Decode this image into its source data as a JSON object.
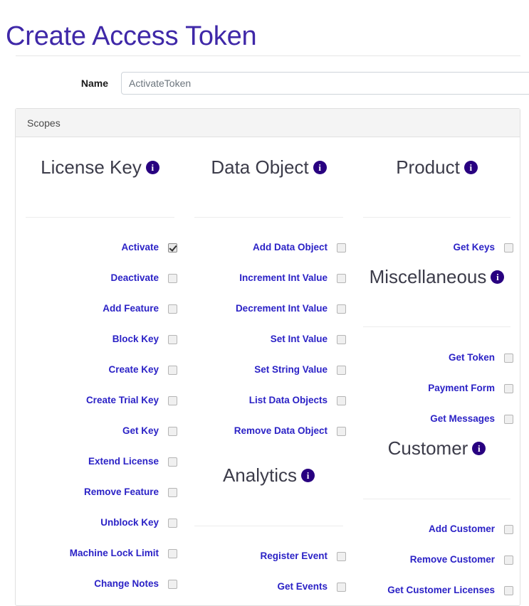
{
  "page": {
    "title": "Create Access Token"
  },
  "form": {
    "name_label": "Name",
    "name_value": "",
    "name_placeholder": "ActivateToken"
  },
  "scopes_card": {
    "header_label": "Scopes"
  },
  "icons": {
    "info": "i",
    "info_name": "info-icon"
  },
  "colors": {
    "title": "#3f28a8",
    "scope_label": "#2b22c6",
    "info_badge": "#280080",
    "card_header_bg": "#f4f4f4",
    "card_border": "#e0e0e0"
  },
  "groups": {
    "license_key": {
      "title": "License Key",
      "items": [
        {
          "label": "Activate",
          "checked": true
        },
        {
          "label": "Deactivate",
          "checked": false
        },
        {
          "label": "Add Feature",
          "checked": false
        },
        {
          "label": "Block Key",
          "checked": false
        },
        {
          "label": "Create Key",
          "checked": false
        },
        {
          "label": "Create Trial Key",
          "checked": false
        },
        {
          "label": "Get Key",
          "checked": false
        },
        {
          "label": "Extend License",
          "checked": false
        },
        {
          "label": "Remove Feature",
          "checked": false
        },
        {
          "label": "Unblock Key",
          "checked": false
        },
        {
          "label": "Machine Lock Limit",
          "checked": false
        },
        {
          "label": "Change Notes",
          "checked": false
        }
      ]
    },
    "data_object": {
      "title": "Data Object",
      "items": [
        {
          "label": "Add Data Object",
          "checked": false
        },
        {
          "label": "Increment Int Value",
          "checked": false
        },
        {
          "label": "Decrement Int Value",
          "checked": false
        },
        {
          "label": "Set Int Value",
          "checked": false
        },
        {
          "label": "Set String Value",
          "checked": false
        },
        {
          "label": "List Data Objects",
          "checked": false
        },
        {
          "label": "Remove Data Object",
          "checked": false
        }
      ]
    },
    "analytics": {
      "title": "Analytics",
      "items": [
        {
          "label": "Register Event",
          "checked": false
        },
        {
          "label": "Get Events",
          "checked": false
        }
      ]
    },
    "product": {
      "title": "Product",
      "items": [
        {
          "label": "Get Keys",
          "checked": false
        }
      ]
    },
    "miscellaneous": {
      "title": "Miscellaneous",
      "items": [
        {
          "label": "Get Token",
          "checked": false
        },
        {
          "label": "Payment Form",
          "checked": false
        },
        {
          "label": "Get Messages",
          "checked": false
        }
      ]
    },
    "customer": {
      "title": "Customer",
      "items": [
        {
          "label": "Add Customer",
          "checked": false
        },
        {
          "label": "Remove Customer",
          "checked": false
        },
        {
          "label": "Get Customer Licenses",
          "checked": false
        }
      ]
    }
  }
}
